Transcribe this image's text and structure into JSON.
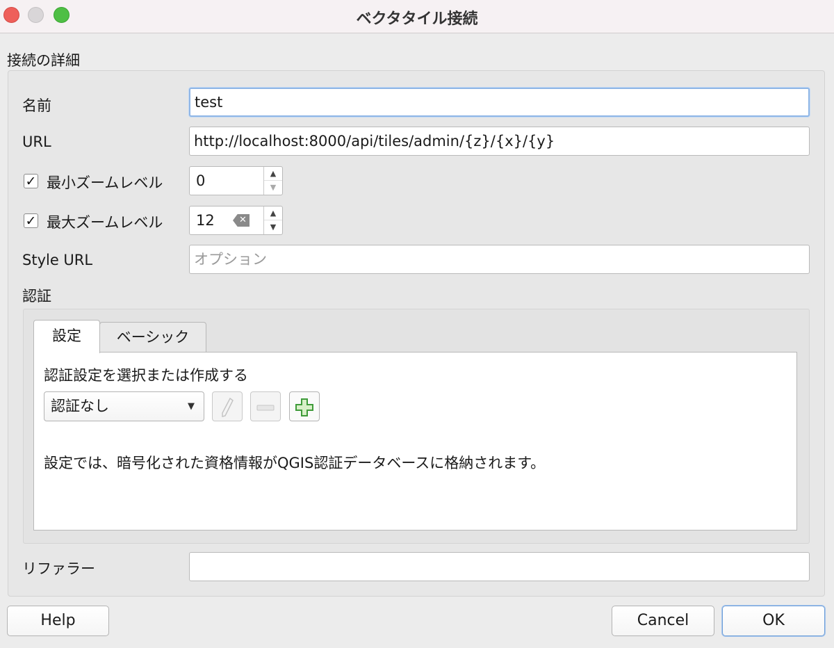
{
  "window": {
    "title": "ベクタタイル接続"
  },
  "connection": {
    "group_title": "接続の詳細",
    "name_label": "名前",
    "name_value": "test",
    "url_label": "URL",
    "url_value": "http://localhost:8000/api/tiles/admin/{z}/{x}/{y}",
    "min_zoom": {
      "label": "最小ズームレベル",
      "checked": true,
      "check_glyph": "✓",
      "value": "0"
    },
    "max_zoom": {
      "label": "最大ズームレベル",
      "checked": true,
      "check_glyph": "✓",
      "value": "12"
    },
    "style_url_label": "Style URL",
    "style_url_placeholder": "オプション",
    "referer_label": "リファラー",
    "referer_value": ""
  },
  "auth": {
    "section_label": "認証",
    "tabs": [
      {
        "label": "設定",
        "active": true
      },
      {
        "label": "ベーシック",
        "active": false
      }
    ],
    "select_prompt": "認証設定を選択または作成する",
    "config_selected": "認証なし",
    "tool_icons": [
      "edit-pencil-icon",
      "remove-minus-icon",
      "add-plus-icon"
    ],
    "info_text": "設定では、暗号化された資格情報がQGIS認証データベースに格納されます。"
  },
  "buttons": {
    "help": "Help",
    "cancel": "Cancel",
    "ok": "OK"
  },
  "colors": {
    "close": "#ee5f5a",
    "minimize": "#d9d6d8",
    "maximize": "#4fbf45",
    "focus_ring": "#8fb6e6",
    "add_icon_green": "#3f9b3a"
  }
}
